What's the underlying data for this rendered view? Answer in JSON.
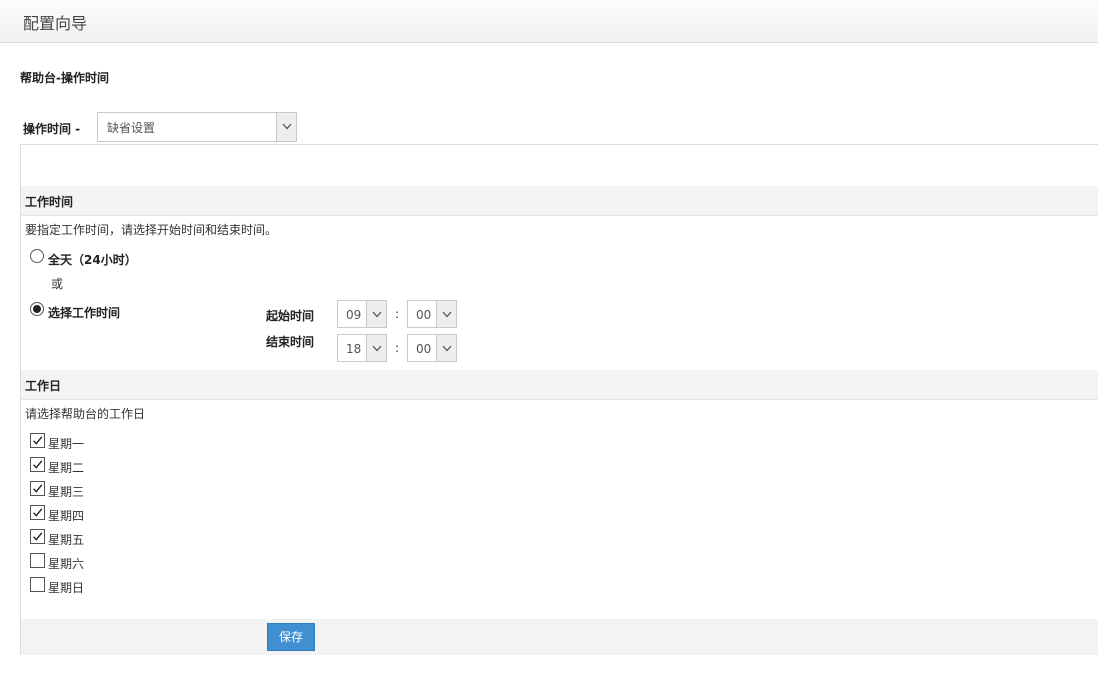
{
  "header": {
    "title": "配置向导"
  },
  "section_title": "帮助台-操作时间",
  "operation_time": {
    "label": "操作时间 -",
    "selected": "缺省设置"
  },
  "work_hours": {
    "title": "工作时间",
    "instruction": "要指定工作时间，请选择开始时间和结束时间。",
    "all_day_label": "全天（24小时）",
    "or_text": "或",
    "select_hours_label": "选择工作时间",
    "selected_option": "选择工作时间",
    "start": {
      "label": "起始时间",
      "hour": "09",
      "minute": "00"
    },
    "end": {
      "label": "结束时间",
      "hour": "18",
      "minute": "00"
    },
    "separator": ":"
  },
  "workdays": {
    "title": "工作日",
    "instruction": "请选择帮助台的工作日",
    "days": [
      {
        "label": "星期一",
        "checked": true
      },
      {
        "label": "星期二",
        "checked": true
      },
      {
        "label": "星期三",
        "checked": true
      },
      {
        "label": "星期四",
        "checked": true
      },
      {
        "label": "星期五",
        "checked": true
      },
      {
        "label": "星期六",
        "checked": false
      },
      {
        "label": "星期日",
        "checked": false
      }
    ]
  },
  "save_label": "保存"
}
